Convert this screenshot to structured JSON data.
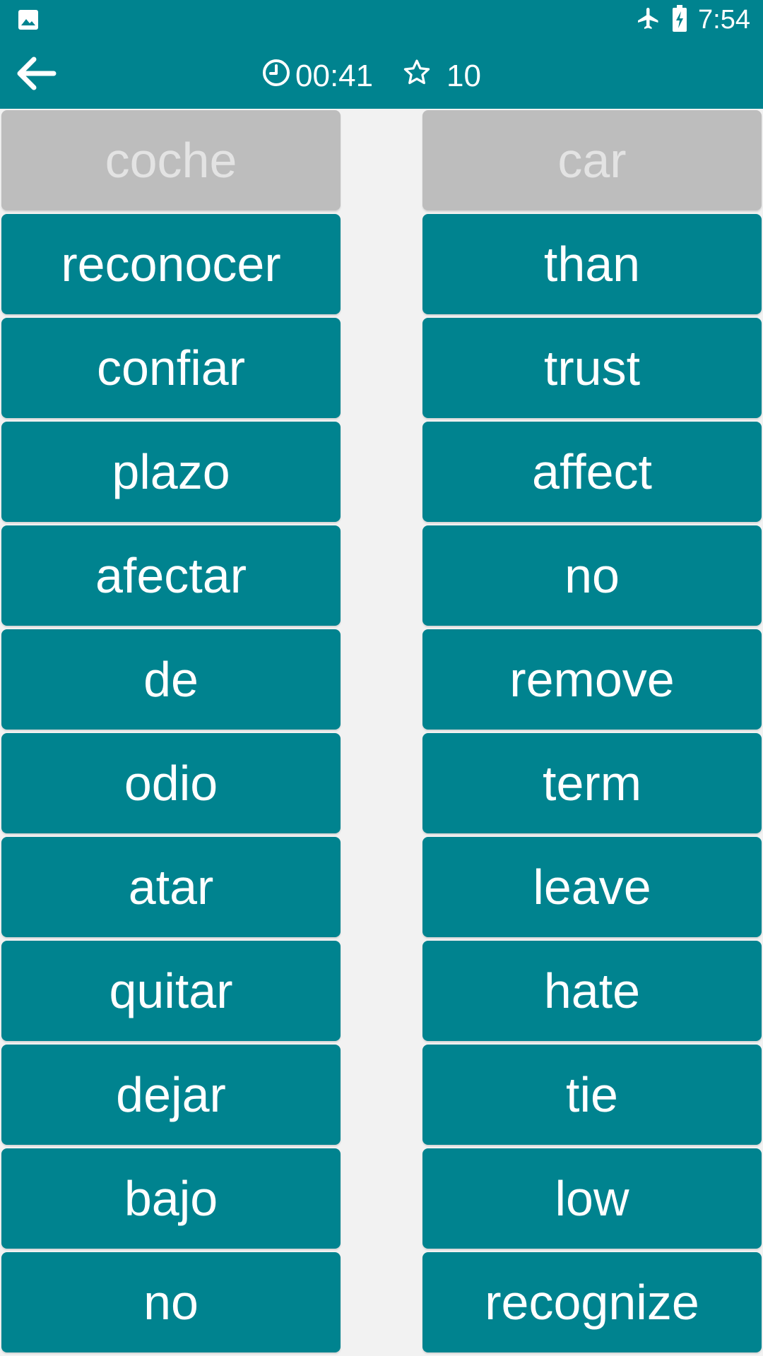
{
  "status": {
    "time": "7:54"
  },
  "header": {
    "timer": "00:41",
    "score": "10"
  },
  "colors": {
    "accent": "#00838F",
    "matched": "#BDBDBD",
    "background": "#F2F2F2"
  },
  "left_words": [
    {
      "text": "coche",
      "matched": true
    },
    {
      "text": "reconocer",
      "matched": false
    },
    {
      "text": "confiar",
      "matched": false
    },
    {
      "text": "plazo",
      "matched": false
    },
    {
      "text": "afectar",
      "matched": false
    },
    {
      "text": "de",
      "matched": false
    },
    {
      "text": "odio",
      "matched": false
    },
    {
      "text": "atar",
      "matched": false
    },
    {
      "text": "quitar",
      "matched": false
    },
    {
      "text": "dejar",
      "matched": false
    },
    {
      "text": "bajo",
      "matched": false
    },
    {
      "text": "no",
      "matched": false
    }
  ],
  "right_words": [
    {
      "text": "car",
      "matched": true
    },
    {
      "text": "than",
      "matched": false
    },
    {
      "text": "trust",
      "matched": false
    },
    {
      "text": "affect",
      "matched": false
    },
    {
      "text": "no",
      "matched": false
    },
    {
      "text": "remove",
      "matched": false
    },
    {
      "text": "term",
      "matched": false
    },
    {
      "text": "leave",
      "matched": false
    },
    {
      "text": "hate",
      "matched": false
    },
    {
      "text": "tie",
      "matched": false
    },
    {
      "text": "low",
      "matched": false
    },
    {
      "text": "recognize",
      "matched": false
    }
  ]
}
